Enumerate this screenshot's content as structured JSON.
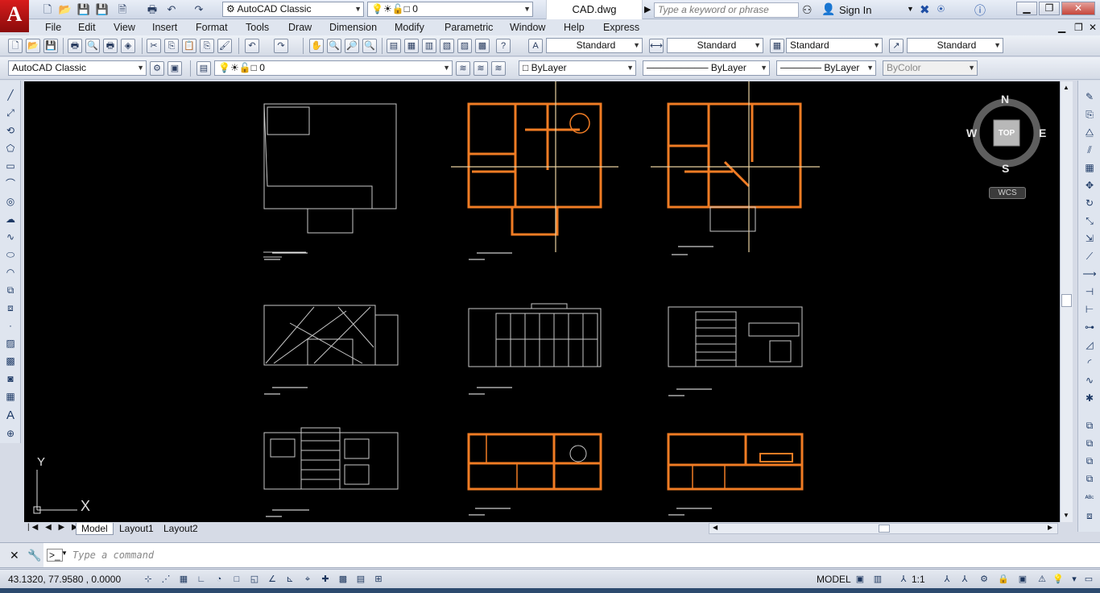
{
  "titlebar": {
    "workspace": "AutoCAD Classic",
    "layer": "0",
    "document_title": "CAD.dwg",
    "search_placeholder": "Type a keyword or phrase",
    "sign_in": "Sign In",
    "logo": "A"
  },
  "menu": [
    "File",
    "Edit",
    "View",
    "Insert",
    "Format",
    "Tools",
    "Draw",
    "Dimension",
    "Modify",
    "Parametric",
    "Window",
    "Help",
    "Express"
  ],
  "styles_toolbar": {
    "text_style": "Standard",
    "dim_style": "Standard",
    "table_style": "Standard",
    "mleader_style": "Standard"
  },
  "layers_toolbar": {
    "workspace": "AutoCAD Classic",
    "layer": "0",
    "color": "ByLayer",
    "linetype": "ByLayer",
    "lineweight": "ByLayer",
    "plotstyle": "ByColor"
  },
  "viewcube": {
    "north": "N",
    "south": "S",
    "east": "E",
    "west": "W",
    "face": "TOP",
    "ucs": "WCS"
  },
  "ucs_icon": {
    "y": "Y",
    "x": "X"
  },
  "layout_tabs": [
    "Model",
    "Layout1",
    "Layout2"
  ],
  "command": {
    "placeholder": "Type a command"
  },
  "status": {
    "coordinates": "43.1320, 77.9580 , 0.0000",
    "space": "MODEL",
    "scale": "1:1"
  },
  "colors": {
    "canvas": "#000000",
    "accent_orange": "#f07c24",
    "line_gray": "#c8c8c8"
  }
}
